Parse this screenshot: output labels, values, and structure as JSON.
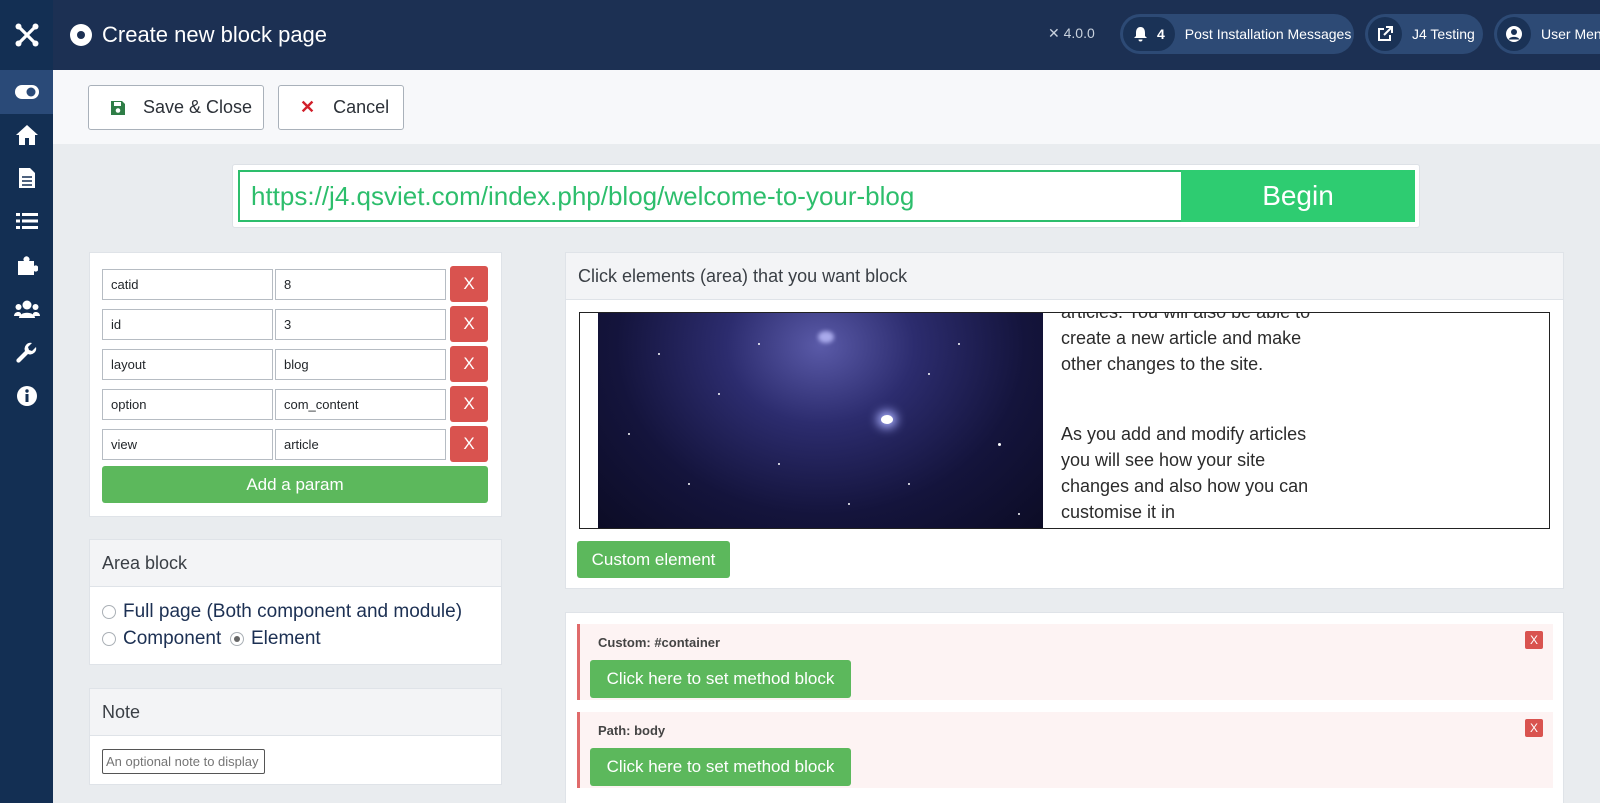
{
  "header": {
    "title": "Create new block page",
    "version": "4.0.0",
    "notifications_count": "4",
    "post_install_label": "Post Installation Messages",
    "site_label": "J4 Testing",
    "user_menu_label": "User Menu"
  },
  "sidebar": {
    "items": [
      {
        "icon": "toggle-icon"
      },
      {
        "icon": "home-icon"
      },
      {
        "icon": "file-icon"
      },
      {
        "icon": "list-icon"
      },
      {
        "icon": "puzzle-icon"
      },
      {
        "icon": "users-icon"
      },
      {
        "icon": "wrench-icon"
      },
      {
        "icon": "info-icon"
      }
    ]
  },
  "toolbar": {
    "save_close_label": "Save & Close",
    "cancel_label": "Cancel"
  },
  "url_bar": {
    "value": "https://j4.qsviet.com/index.php/blog/welcome-to-your-blog",
    "begin_label": "Begin"
  },
  "params": {
    "rows": [
      {
        "key": "catid",
        "value": "8",
        "remove": "X"
      },
      {
        "key": "id",
        "value": "3",
        "remove": "X"
      },
      {
        "key": "layout",
        "value": "blog",
        "remove": "X"
      },
      {
        "key": "option",
        "value": "com_content",
        "remove": "X"
      },
      {
        "key": "view",
        "value": "article",
        "remove": "X"
      }
    ],
    "add_label": "Add a param"
  },
  "area_block": {
    "title": "Area block",
    "options": [
      {
        "label": "Full page (Both component and module)",
        "selected": false
      },
      {
        "label": "Component",
        "selected": false
      },
      {
        "label": "Element",
        "selected": true
      }
    ]
  },
  "note": {
    "title": "Note",
    "placeholder": "An optional note to display"
  },
  "preview": {
    "title": "Click elements (area) that you want block",
    "text_top": "articles. You will also be able to create a new article and make other changes to the site.",
    "text_bottom": "As you add and modify articles you will see how your site changes and also how you can customise it in",
    "custom_element_label": "Custom element"
  },
  "blocks": [
    {
      "label": "Custom: #container",
      "button": "Click here to set method block",
      "remove": "X"
    },
    {
      "label": "Path: body",
      "button": "Click here to set method block",
      "remove": "X"
    }
  ],
  "colors": {
    "sidebar": "#132f53",
    "header": "#1c3053",
    "success": "#5cb85c",
    "url_green": "#2ecc71",
    "danger": "#d9534f"
  }
}
